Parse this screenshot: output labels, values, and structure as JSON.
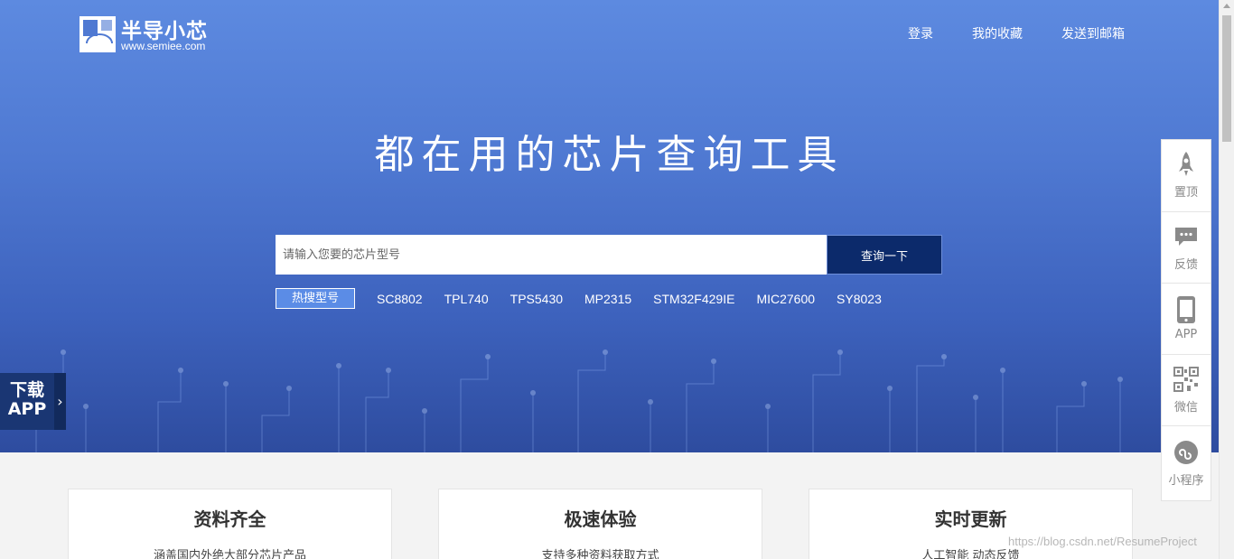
{
  "header": {
    "logo_title": "半导小芯",
    "logo_url": "www.semiee.com",
    "nav": [
      "登录",
      "我的收藏",
      "发送到邮箱"
    ]
  },
  "hero": {
    "headline": "都在用的芯片查询工具"
  },
  "search": {
    "placeholder": "请输入您要的芯片型号",
    "button_label": "查询一下"
  },
  "hot": {
    "tag": "热搜型号",
    "items": [
      "SC8802",
      "TPL740",
      "TPS5430",
      "MP2315",
      "STM32F429IE",
      "MIC27600",
      "SY8023"
    ]
  },
  "download": {
    "line1": "下载",
    "line2": "APP",
    "arrow": "›"
  },
  "sidebar": {
    "items": [
      {
        "label": "置顶",
        "icon": "rocket-icon"
      },
      {
        "label": "反馈",
        "icon": "chat-bubble-icon"
      },
      {
        "label": "APP",
        "icon": "phone-icon"
      },
      {
        "label": "微信",
        "icon": "qr-code-icon"
      },
      {
        "label": "小程序",
        "icon": "mini-program-icon"
      }
    ]
  },
  "features": [
    {
      "title": "资料齐全",
      "desc": "涵盖国内外绝大部分芯片产品"
    },
    {
      "title": "极速体验",
      "desc": "支持多种资料获取方式"
    },
    {
      "title": "实时更新",
      "desc": "人工智能 动态反馈"
    }
  ],
  "watermark": "https://blog.csdn.net/ResumeProject",
  "colors": {
    "hero_top": "#5d8ae0",
    "hero_bottom": "#2e4c9f",
    "search_button": "#0c2a6b",
    "hot_tag": "#5b8ce6",
    "download_bg": "#1a3673"
  }
}
